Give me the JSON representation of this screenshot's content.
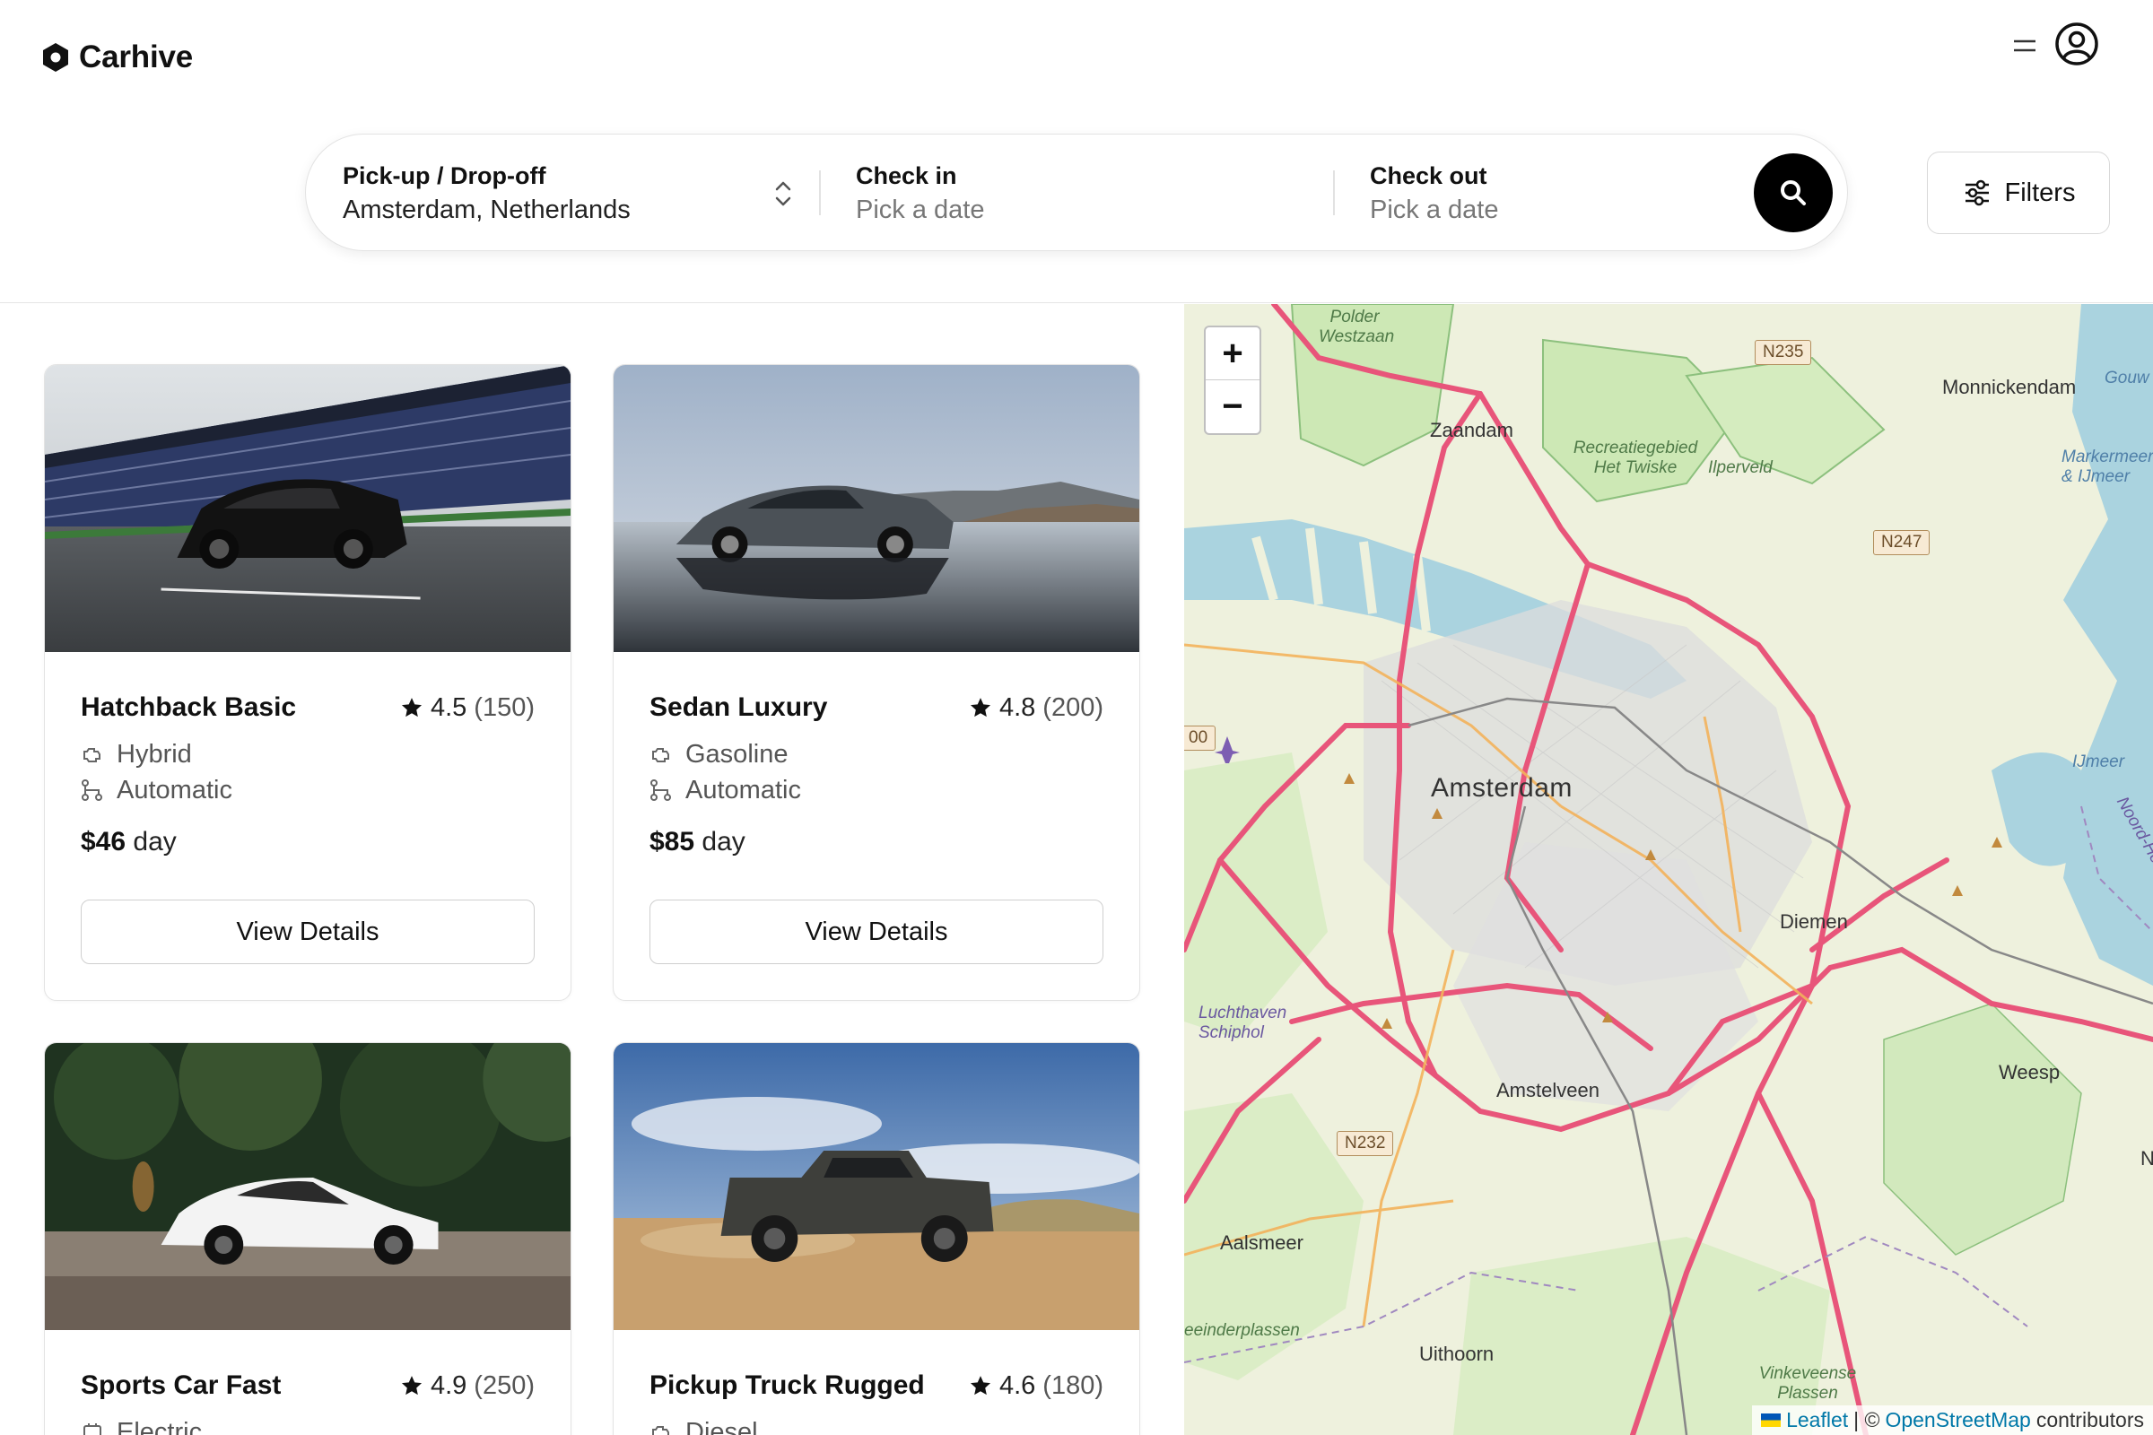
{
  "app": {
    "name": "Carhive"
  },
  "search": {
    "location_label": "Pick-up / Drop-off",
    "location_value": "Amsterdam, Netherlands",
    "checkin_label": "Check in",
    "checkin_placeholder": "Pick a date",
    "checkout_label": "Check out",
    "checkout_placeholder": "Pick a date"
  },
  "filters_label": "Filters",
  "listings": [
    {
      "title": "Hatchback Basic",
      "rating": "4.5",
      "reviews": "(150)",
      "fuel": "Hybrid",
      "transmission": "Automatic",
      "price": "$46",
      "price_unit": "day",
      "button": "View Details"
    },
    {
      "title": "Sedan Luxury",
      "rating": "4.8",
      "reviews": "(200)",
      "fuel": "Gasoline",
      "transmission": "Automatic",
      "price": "$85",
      "price_unit": "day",
      "button": "View Details"
    },
    {
      "title": "Sports Car Fast",
      "rating": "4.9",
      "reviews": "(250)",
      "fuel": "Electric"
    },
    {
      "title": "Pickup Truck Rugged",
      "rating": "4.6",
      "reviews": "(180)",
      "fuel": "Diesel"
    }
  ],
  "map": {
    "zoom_in": "+",
    "zoom_out": "−",
    "labels": {
      "city": "Amsterdam",
      "zaandam": "Zaandam",
      "monnickendam": "Monnickendam",
      "diemen": "Diemen",
      "amstelveen": "Amstelveen",
      "aalsmeer": "Aalsmeer",
      "uithoorn": "Uithoorn",
      "weesp": "Weesp",
      "schiphol": "Luchthaven Schiphol",
      "twiske": "Recreatiegebied Het Twiske",
      "ilperveld": "Ilperveld",
      "polder": "Polder Westzaan",
      "markermeer": "Markermeer & IJmeer",
      "ijmeer": "IJmeer",
      "vinkeveen": "Vinkeveense Plassen",
      "westeinder": "eeinderplassen",
      "gouw": "Gouw",
      "noord": "Noord-Hol",
      "n_right": "N"
    },
    "road_badges": {
      "n235": "N235",
      "n247": "N247",
      "n232": "N232",
      "a200": "00"
    },
    "attribution": {
      "leaflet": "Leaflet",
      "sep": "| ©",
      "osm": "OpenStreetMap",
      "contrib": "contributors"
    }
  }
}
